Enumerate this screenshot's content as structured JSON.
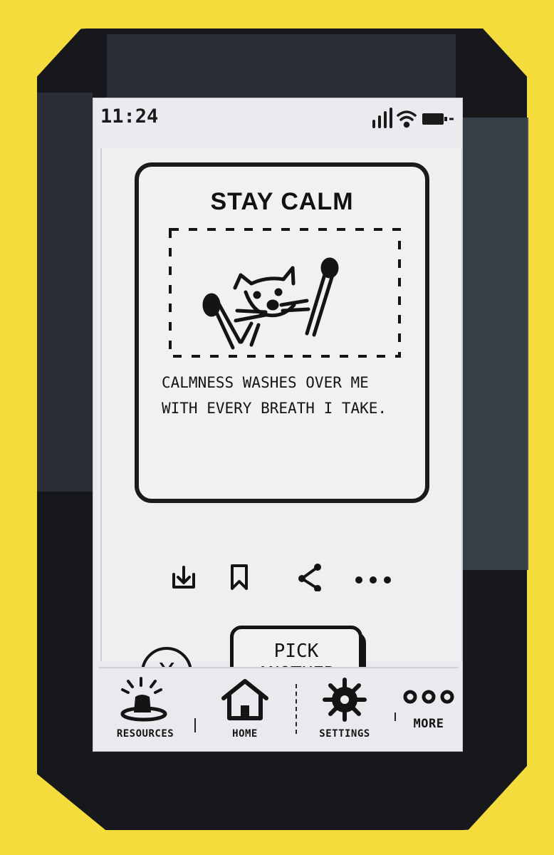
{
  "status_bar": {
    "time": "11:24"
  },
  "card": {
    "title": "STAY CALM",
    "image_icon": "cat-sketch-icon",
    "affirmation": "CALMNESS WASHES OVER ME WITH EVERY BREATH I TAKE."
  },
  "card_actions": [
    {
      "icon": "download-icon"
    },
    {
      "icon": "bookmark-icon"
    },
    {
      "icon": "share-icon"
    },
    {
      "icon": "more-dots-icon"
    }
  ],
  "controls": {
    "close_symbol": "X",
    "pick_another_line1": "PICK",
    "pick_another_line2": "ANOTHER"
  },
  "nav": {
    "items": [
      {
        "label": "RESOURCES",
        "icon": "bell-icon"
      },
      {
        "label": "HOME",
        "icon": "home-icon"
      },
      {
        "label": "SETTINGS",
        "icon": "gear-icon"
      },
      {
        "label": "MORE",
        "icon": "more-dots-icon"
      }
    ]
  }
}
